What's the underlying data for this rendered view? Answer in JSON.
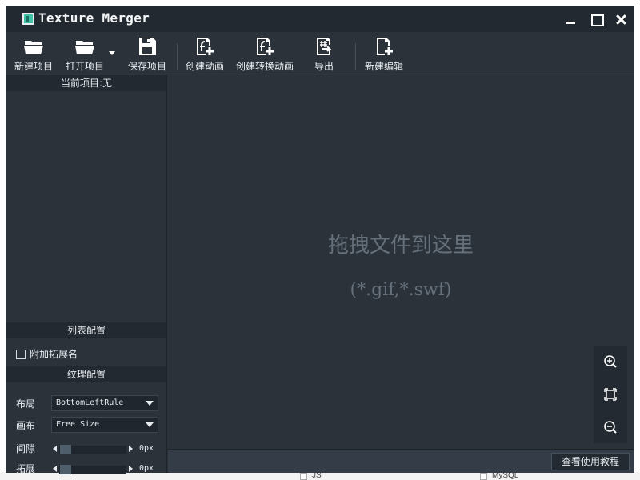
{
  "window": {
    "title": "Texture Merger"
  },
  "toolbar": {
    "new_project": "新建项目",
    "open_project": "打开项目",
    "save_project": "保存项目",
    "create_animation": "创建动画",
    "create_convert_animation": "创建转换动画",
    "export": "导出",
    "new_edit": "新建编辑"
  },
  "left_panel": {
    "current_project": "当前项目:无",
    "list_config": "列表配置",
    "append_ext_label": "附加拓展名",
    "append_ext_checked": false,
    "texture_config": "纹理配置",
    "layout_label": "布局",
    "layout_value": "BottomLeftRule",
    "canvas_label": "画布",
    "canvas_value": "Free Size",
    "gap_label": "间隙",
    "gap_value": "0px",
    "gap_level": 0,
    "extend_label": "拓展",
    "extend_value": "0px",
    "extend_level": 0
  },
  "canvas": {
    "drop_hint": "拖拽文件到这里",
    "drop_types": "(*.gif,*.swf)"
  },
  "status": {
    "tutorial_button": "查看使用教程"
  },
  "background_app": {
    "items": [
      "JS",
      "MySQL"
    ]
  },
  "colors": {
    "window_bg": "#2b323a",
    "titlebar_bg": "#222931",
    "panel_header_bg": "#222930",
    "hint_text": "#65707b",
    "app_icon_accent": "#3fc2a5"
  }
}
